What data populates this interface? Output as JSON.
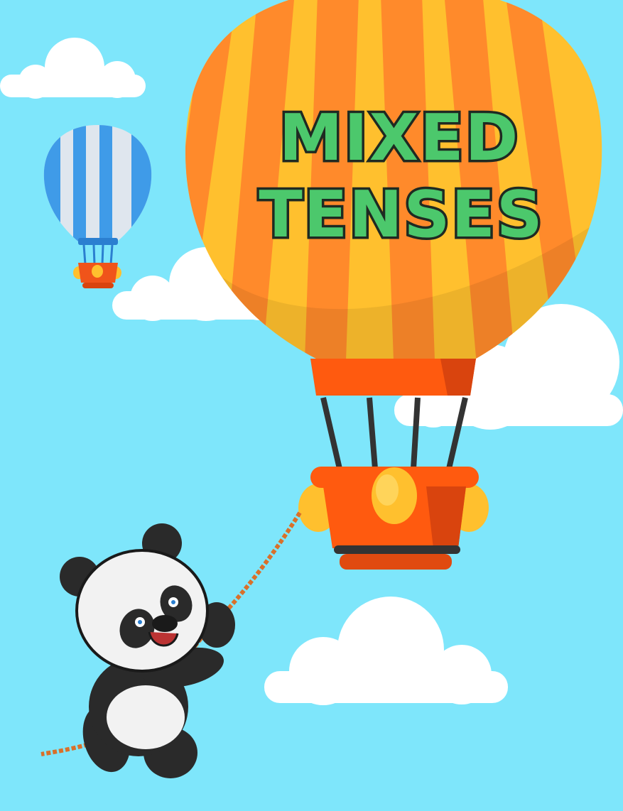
{
  "title": {
    "line1": "MIXED",
    "line2": "TENSES"
  },
  "colors": {
    "sky": "#7ee6fb",
    "cloud": "#ffffff",
    "big_balloon_orange": "#ff8a2b",
    "big_balloon_yellow": "#ffc02e",
    "basket_red": "#ff5a0f",
    "small_balloon_blue": "#3f9be8",
    "title_green": "#4cc86c",
    "rope": "#d9702a",
    "panda_black": "#2a2a2a",
    "panda_white": "#f2f2f2"
  },
  "elements": {
    "clouds": [
      "cloud",
      "cloud",
      "cloud",
      "cloud"
    ],
    "balloons": [
      "large-orange-hot-air-balloon",
      "small-blue-hot-air-balloon"
    ],
    "character": "panda-hanging-on-rope"
  }
}
